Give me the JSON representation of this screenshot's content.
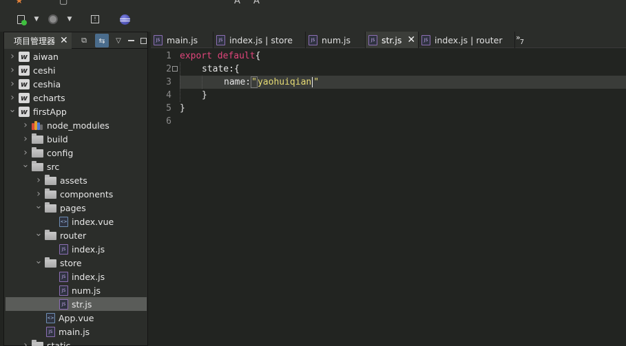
{
  "toolbar": {
    "icons": [
      "run-icon",
      "dropdown-icon",
      "browser-icon",
      "dropdown-icon",
      "note-icon",
      "eclipse-icon"
    ]
  },
  "explorer": {
    "title": "项目管理器",
    "tree": [
      {
        "label": "aiwan",
        "depth": 0,
        "icon": "project",
        "expanded": false
      },
      {
        "label": "ceshi",
        "depth": 0,
        "icon": "project",
        "expanded": false
      },
      {
        "label": "ceshia",
        "depth": 0,
        "icon": "project",
        "expanded": false
      },
      {
        "label": "echarts",
        "depth": 0,
        "icon": "project",
        "expanded": false
      },
      {
        "label": "firstApp",
        "depth": 0,
        "icon": "project",
        "expanded": true
      },
      {
        "label": "node_modules",
        "depth": 1,
        "icon": "library",
        "expanded": false
      },
      {
        "label": "build",
        "depth": 1,
        "icon": "folder",
        "expanded": false
      },
      {
        "label": "config",
        "depth": 1,
        "icon": "folder",
        "expanded": false
      },
      {
        "label": "src",
        "depth": 1,
        "icon": "folder",
        "expanded": true
      },
      {
        "label": "assets",
        "depth": 2,
        "icon": "folder",
        "expanded": false
      },
      {
        "label": "components",
        "depth": 2,
        "icon": "folder",
        "expanded": false
      },
      {
        "label": "pages",
        "depth": 2,
        "icon": "folder",
        "expanded": true
      },
      {
        "label": "index.vue",
        "depth": 3,
        "icon": "vue",
        "expanded": null
      },
      {
        "label": "router",
        "depth": 2,
        "icon": "folder",
        "expanded": true
      },
      {
        "label": "index.js",
        "depth": 3,
        "icon": "js",
        "expanded": null
      },
      {
        "label": "store",
        "depth": 2,
        "icon": "folder",
        "expanded": true
      },
      {
        "label": "index.js",
        "depth": 3,
        "icon": "js",
        "expanded": null
      },
      {
        "label": "num.js",
        "depth": 3,
        "icon": "js",
        "expanded": null
      },
      {
        "label": "str.js",
        "depth": 3,
        "icon": "js",
        "expanded": null,
        "selected": true
      },
      {
        "label": "App.vue",
        "depth": 2,
        "icon": "vue",
        "expanded": null
      },
      {
        "label": "main.js",
        "depth": 2,
        "icon": "js",
        "expanded": null
      },
      {
        "label": "static",
        "depth": 1,
        "icon": "folder",
        "expanded": false
      }
    ]
  },
  "editor": {
    "tabs": [
      {
        "label": "main.js",
        "active": false
      },
      {
        "label": "index.js | store",
        "active": false
      },
      {
        "label": "num.js",
        "active": false
      },
      {
        "label": "str.js",
        "active": true
      },
      {
        "label": "index.js | router",
        "active": false
      }
    ],
    "overflow_count": "7",
    "overflow_marker": "»",
    "lines": [
      "1",
      "2",
      "3",
      "4",
      "5",
      "6"
    ],
    "code": {
      "l1_kw": "export default",
      "l1_rest": "{",
      "l2": "state:{",
      "l3_key": "name:",
      "l3_value": "yaohuiqian",
      "l4": "}",
      "l5": "}"
    }
  }
}
